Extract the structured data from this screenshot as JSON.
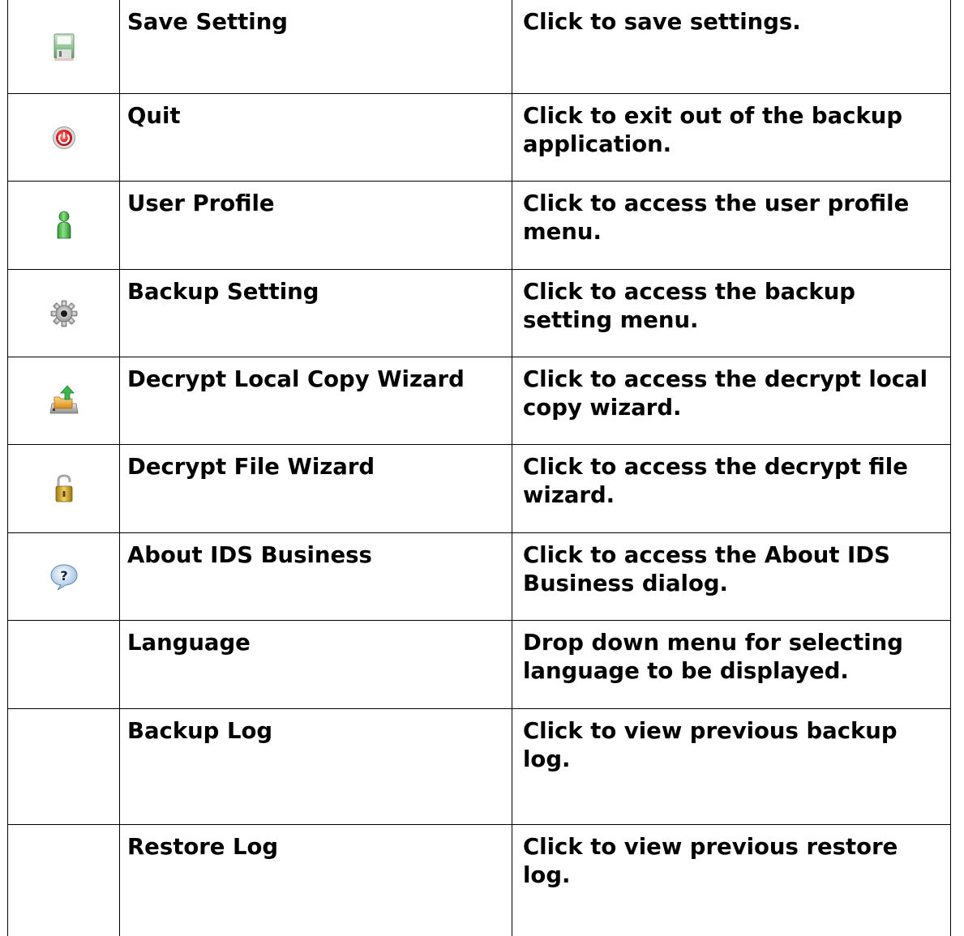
{
  "rows": [
    {
      "icon": "save-disk-icon",
      "name": "Save Setting",
      "description": "Click to save settings."
    },
    {
      "icon": "quit-power-icon",
      "name": "Quit",
      "description": "Click to exit out of the backup application."
    },
    {
      "icon": "user-profile-icon",
      "name": "User Profile",
      "description": "Click to access the user profile menu."
    },
    {
      "icon": "gear-icon",
      "name": "Backup Setting",
      "description": "Click to access the backup setting menu."
    },
    {
      "icon": "decrypt-local-copy-icon",
      "name": "Decrypt Local Copy Wizard",
      "description": "Click to access the decrypt local copy wizard."
    },
    {
      "icon": "padlock-open-icon",
      "name": "Decrypt File Wizard",
      "description": "Click to access the decrypt file wizard."
    },
    {
      "icon": "help-question-icon",
      "name": "About IDS Business",
      "description": "Click to access the About IDS Business dialog."
    },
    {
      "icon": "",
      "name": "Language",
      "description": "Drop down menu for selecting language to be displayed."
    },
    {
      "icon": "",
      "name": "Backup Log",
      "description": "Click to view previous backup log."
    },
    {
      "icon": "",
      "name": "Restore Log",
      "description": "Click to view previous restore log."
    }
  ]
}
